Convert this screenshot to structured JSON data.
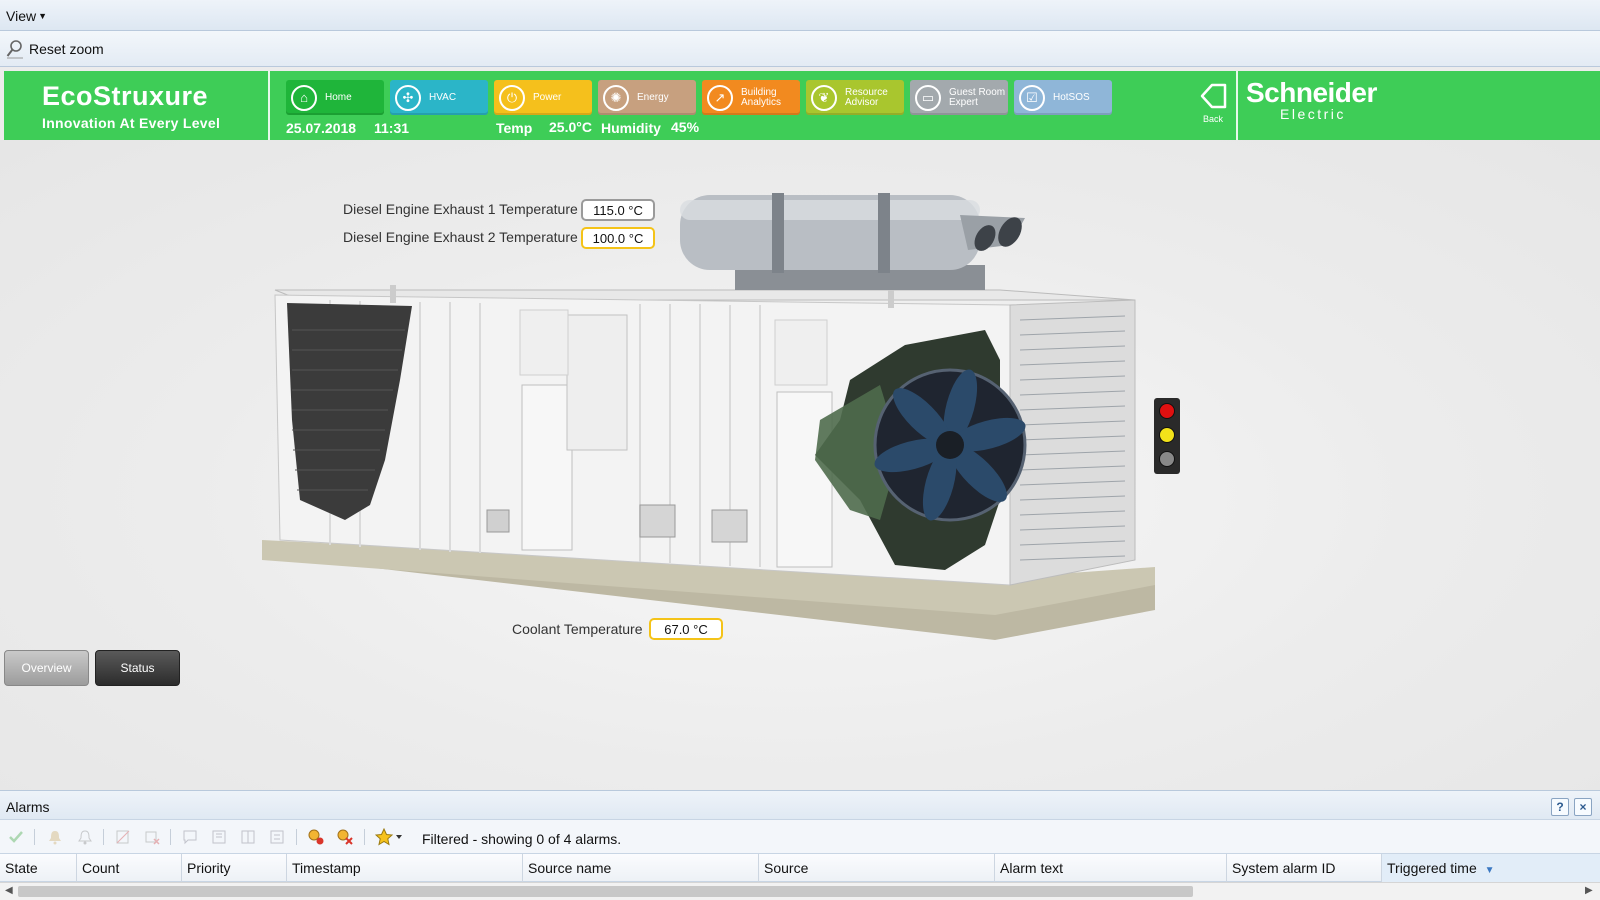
{
  "menu": {
    "view_label": "View"
  },
  "toolbar": {
    "reset_zoom_label": "Reset zoom"
  },
  "header": {
    "brand": {
      "name": "EcoStruxure",
      "tagline": "Innovation At Every Level"
    },
    "date": "25.07.2018",
    "time": "11:31",
    "temp_label": "Temp",
    "temp_value": "25.0°C",
    "humidity_label": "Humidity",
    "humidity_value": "45%",
    "back_label": "Back",
    "vendor": {
      "name": "Schneider",
      "sub": "Electric"
    },
    "nav": [
      {
        "label": "Home",
        "icon": "home-icon",
        "color": "#1fb53a"
      },
      {
        "label": "HVAC",
        "icon": "fan-icon",
        "color": "#2bb5c8"
      },
      {
        "label": "Power",
        "icon": "plug-icon",
        "color": "#f5c01c"
      },
      {
        "label": "Energy",
        "icon": "energy-icon",
        "color": "#c7a07f"
      },
      {
        "label": "Building Analytics",
        "icon": "chart-icon",
        "color": "#f28a1f"
      },
      {
        "label": "Resource Advisor",
        "icon": "leaf-icon",
        "color": "#a9c62e"
      },
      {
        "label": "Guest Room Expert",
        "icon": "bed-icon",
        "color": "#a3a9ad"
      },
      {
        "label": "HotSOS",
        "icon": "checklist-icon",
        "color": "#8fb6d8"
      }
    ]
  },
  "points": {
    "exhaust1": {
      "label": "Diesel Engine Exhaust 1 Temperature",
      "value": "115.0 °C",
      "state": "normal"
    },
    "exhaust2": {
      "label": "Diesel Engine Exhaust 2 Temperature",
      "value": "100.0 °C",
      "state": "warning"
    },
    "coolant": {
      "label": "Coolant Temperature",
      "value": "67.0 °C",
      "state": "warning"
    }
  },
  "traffic_light": {
    "red": "#e01010",
    "yellow": "#f2e21a",
    "off": "#888888"
  },
  "view_buttons": {
    "overview_label": "Overview",
    "status_label": "Status"
  },
  "alarms": {
    "title": "Alarms",
    "help_label": "?",
    "close_label": "×",
    "filter_text": "Filtered - showing 0 of 4 alarms.",
    "columns": [
      "State",
      "Count",
      "Priority",
      "Timestamp",
      "Source name",
      "Source",
      "Alarm text",
      "System alarm ID",
      "Triggered time"
    ],
    "sorted_column": "Triggered time"
  }
}
